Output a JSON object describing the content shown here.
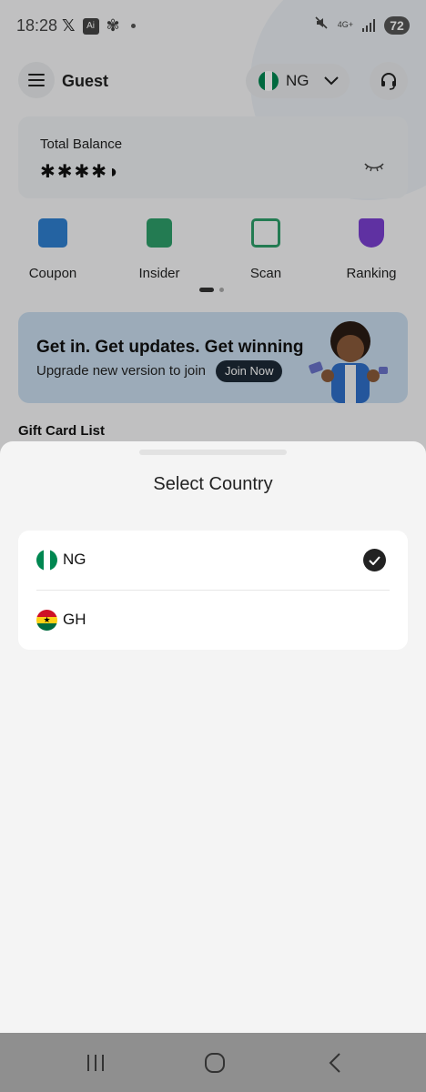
{
  "status_bar": {
    "time": "18:28",
    "x_glyph": "𝕏",
    "ai_badge": "Ai",
    "network": "4G+",
    "battery": "72"
  },
  "header": {
    "user_label": "Guest",
    "country_code": "NG"
  },
  "balance": {
    "title": "Total Balance",
    "masked_value": "✱✱✱✱◗"
  },
  "quick_actions": [
    {
      "label": "Coupon",
      "icon": "coupon-icon",
      "color": "#2f7fd0"
    },
    {
      "label": "Insider",
      "icon": "insider-icon",
      "color": "#2e9e6a"
    },
    {
      "label": "Scan",
      "icon": "scan-icon",
      "color": "#2e9e6a"
    },
    {
      "label": "Ranking",
      "icon": "trophy-icon",
      "color": "#7a3fd0"
    }
  ],
  "banner": {
    "title": "Get in. Get updates. Get winning",
    "subtitle": "Upgrade new version to join",
    "button": "Join Now"
  },
  "section": {
    "gift_card_title": "Gift Card List"
  },
  "sheet": {
    "title": "Select Country",
    "countries": [
      {
        "code": "NG",
        "selected": true
      },
      {
        "code": "GH",
        "selected": false
      }
    ]
  },
  "colors": {
    "nigeria_green": "#008751",
    "ghana_red": "#ce1126",
    "ghana_gold": "#fcd116",
    "ghana_green": "#006b3f",
    "dark": "#222222"
  }
}
